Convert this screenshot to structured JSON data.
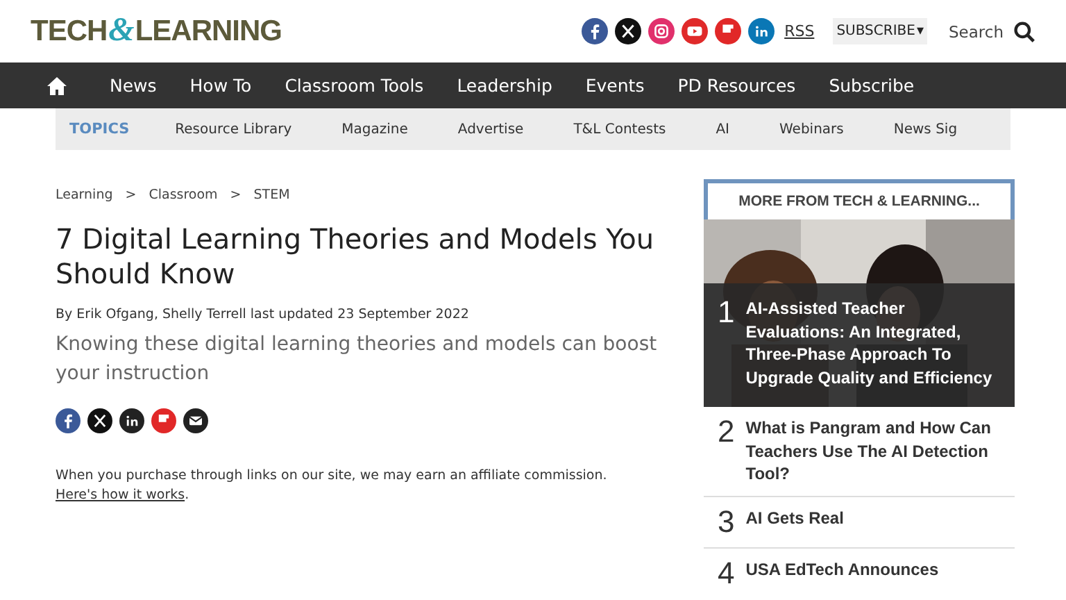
{
  "header": {
    "logo": {
      "left": "TECH",
      "amp": "&",
      "right": "LEARNING"
    },
    "social": [
      {
        "kind": "facebook"
      },
      {
        "kind": "x"
      },
      {
        "kind": "instagram"
      },
      {
        "kind": "youtube"
      },
      {
        "kind": "flipboard"
      },
      {
        "kind": "linkedin"
      }
    ],
    "rss": "RSS",
    "subscribe": {
      "label": "SUBSCRIBE",
      "caret": "▾"
    },
    "search": "Search"
  },
  "nav": {
    "items": [
      "News",
      "How To",
      "Classroom Tools",
      "Leadership",
      "Events",
      "PD Resources",
      "Subscribe"
    ]
  },
  "topics": {
    "label": "TOPICS",
    "items": [
      "Resource Library",
      "Magazine",
      "Advertise",
      "T&L Contests",
      "AI",
      "Webinars",
      "News Sig"
    ]
  },
  "breadcrumb": [
    "Learning",
    "Classroom",
    "STEM"
  ],
  "breadcrumb_separator": ">",
  "article": {
    "title": "7 Digital Learning Theories and Models You Should Know",
    "byline": "By Erik Ofgang, Shelly Terrell last updated 23 September 2022",
    "standfirst": "Knowing these digital learning theories and models can boost your instruction",
    "share": [
      {
        "kind": "facebook"
      },
      {
        "kind": "x"
      },
      {
        "kind": "linkedin"
      },
      {
        "kind": "flipboard"
      },
      {
        "kind": "email"
      }
    ],
    "disclaimer": "When you purchase through links on our site, we may earn an affiliate commission.",
    "disclaimer_link": "Here's how it works",
    "disclaimer_end": "."
  },
  "sidebar": {
    "heading": "MORE FROM TECH & LEARNING...",
    "items": [
      {
        "number": "1",
        "title": "AI-Assisted Teacher Evaluations: An Integrated, Three-Phase Approach To Upgrade Quality and Efficiency",
        "kind": "featured"
      },
      {
        "number": "2",
        "title": "What is Pangram and How Can Teachers Use The AI Detection Tool?",
        "kind": "plain"
      },
      {
        "number": "3",
        "title": "AI Gets Real",
        "kind": "plain"
      },
      {
        "number": "4",
        "title": "USA EdTech Announces",
        "kind": "plain"
      }
    ]
  }
}
